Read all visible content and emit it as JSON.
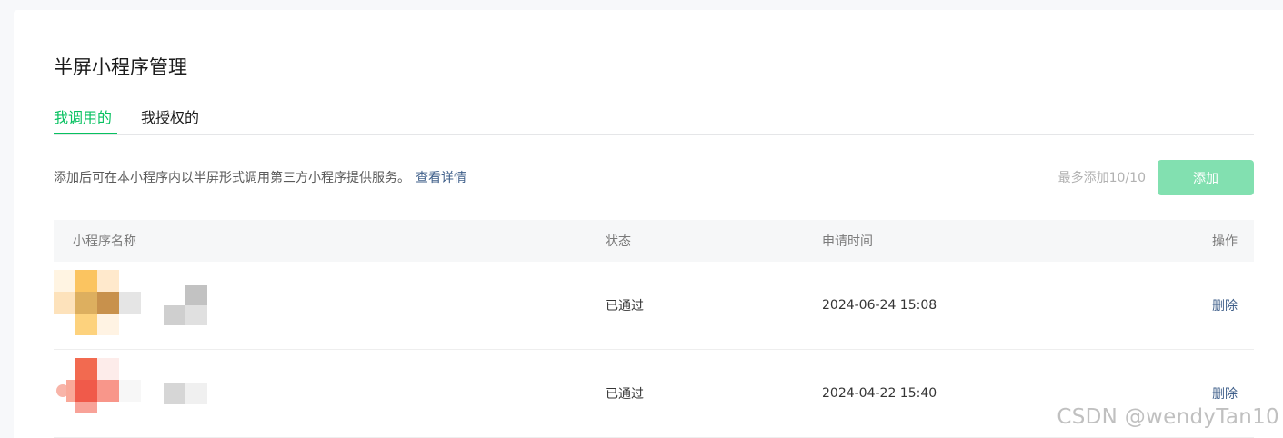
{
  "page": {
    "title": "半屏小程序管理"
  },
  "tabs": [
    {
      "label": "我调用的",
      "active": true
    },
    {
      "label": "我授权的",
      "active": false
    }
  ],
  "description": {
    "text": "添加后可在本小程序内以半屏形式调用第三方小程序提供服务。",
    "link": "查看详情"
  },
  "limit_text": "最多添加10/10",
  "add_button": "添加",
  "table": {
    "headers": {
      "name": "小程序名称",
      "status": "状态",
      "time": "申请时间",
      "operation": "操作"
    },
    "rows": [
      {
        "status": "已通过",
        "time": "2024-06-24 15:08",
        "action": "删除",
        "avatar_color": "#fbc460"
      },
      {
        "status": "已通过",
        "time": "2024-04-22 15:40",
        "action": "删除",
        "avatar_color": "#f26a50"
      }
    ]
  },
  "watermark": "CSDN @wendyTan10",
  "colors": {
    "accent": "#07c160",
    "link": "#3f5f8a",
    "disabled_button": "#82e0b0"
  }
}
